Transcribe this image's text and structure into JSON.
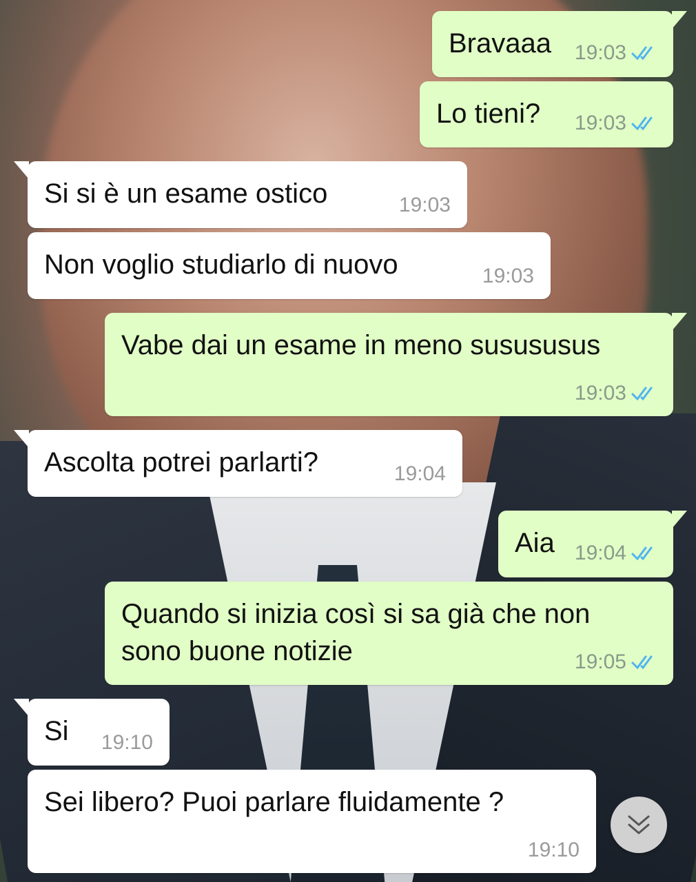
{
  "messages": [
    {
      "direction": "out",
      "text": "Bravaaa",
      "time": "19:03",
      "status": "read"
    },
    {
      "direction": "out",
      "text": "Lo tieni?",
      "time": "19:03",
      "status": "read"
    },
    {
      "direction": "in",
      "text": "Si si è un esame ostico",
      "time": "19:03"
    },
    {
      "direction": "in",
      "text": "Non voglio studiarlo di nuovo",
      "time": "19:03"
    },
    {
      "direction": "out",
      "text": "Vabe dai un esame in meno susususus",
      "time": "19:03",
      "status": "read"
    },
    {
      "direction": "in",
      "text": "Ascolta potrei parlarti?",
      "time": "19:04"
    },
    {
      "direction": "out",
      "text": "Aia",
      "time": "19:04",
      "status": "read"
    },
    {
      "direction": "out",
      "text_line1": "Quando si inizia così si sa già che non",
      "text_line2": "sono buone notizie",
      "time": "19:05",
      "status": "read"
    },
    {
      "direction": "in",
      "text": "Si",
      "time": "19:10"
    },
    {
      "direction": "in",
      "text": "Sei libero? Puoi parlare fluidamente ?",
      "time": "19:10"
    }
  ],
  "colors": {
    "outgoing_bubble": "#e1fec6",
    "incoming_bubble": "#ffffff",
    "read_ticks": "#4fb4f0",
    "timestamp": "#8a9a8a"
  },
  "icons": {
    "read_receipt": "double-check-icon",
    "scroll_down": "double-chevron-down-icon"
  }
}
